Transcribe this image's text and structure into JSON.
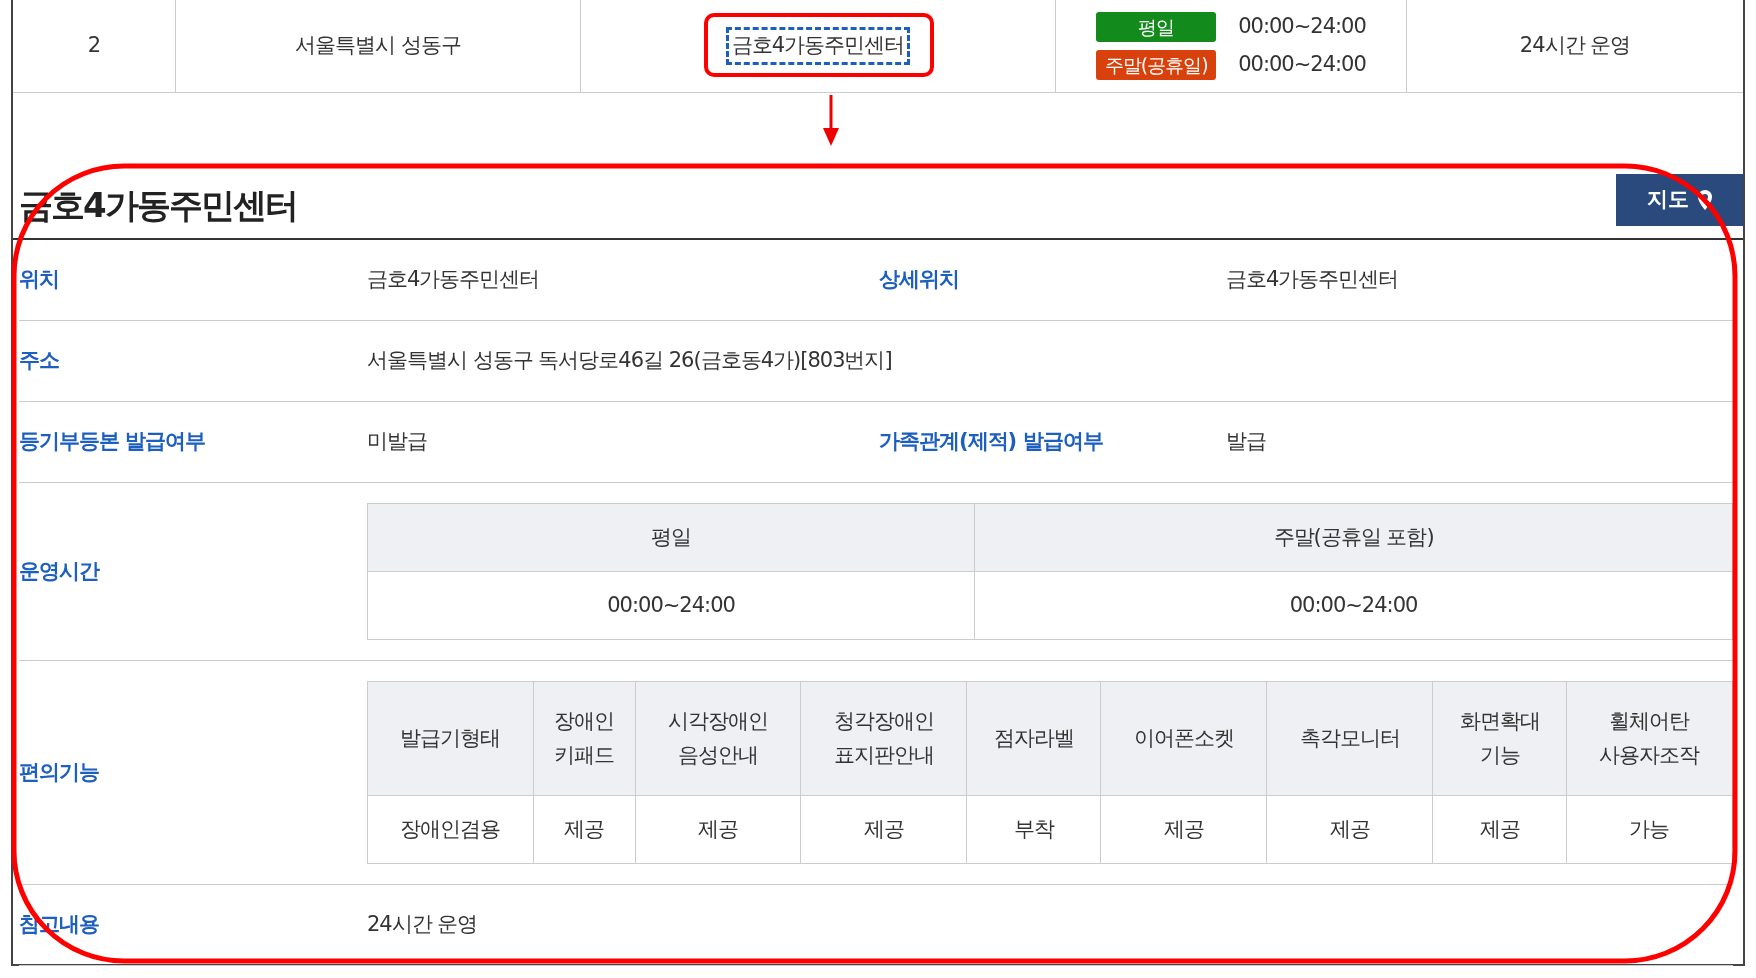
{
  "list_row": {
    "number": "2",
    "region": "서울특별시 성동구",
    "center_link": "금호4가동주민센터",
    "hours": [
      {
        "badge": "평일",
        "color": "#138a1c",
        "time": "00:00~24:00"
      },
      {
        "badge": "주말(공휴일)",
        "color": "#d8410c",
        "time": "00:00~24:00"
      }
    ],
    "note": "24시간 운영"
  },
  "detail": {
    "title": "금호4가동주민센터",
    "map_button": "지도",
    "rows": [
      {
        "kind": "pair",
        "label": "위치",
        "value": "금호4가동주민센터",
        "label2": "상세위치",
        "value2": "금호4가동주민센터"
      },
      {
        "kind": "single",
        "label": "주소",
        "value": "서울특별시 성동구 독서당로46길 26(금호동4가)[803번지]"
      },
      {
        "kind": "pair",
        "label": "등기부등본 발급여부",
        "value": "미발급",
        "label2": "가족관계(제적) 발급여부",
        "value2": "발급"
      },
      {
        "kind": "table",
        "label": "운영시간",
        "columns": [
          "평일",
          "주말(공휴일 포함)"
        ],
        "values": [
          "00:00~24:00",
          "00:00~24:00"
        ]
      },
      {
        "kind": "table",
        "label": "편의기능",
        "columns": [
          "발급기형태",
          "장애인\n키패드",
          "시각장애인\n음성안내",
          "청각장애인\n표지판안내",
          "점자라벨",
          "이어폰소켓",
          "촉각모니터",
          "화면확대\n기능",
          "휠체어탄\n사용자조작"
        ],
        "values": [
          "장애인겸용",
          "제공",
          "제공",
          "제공",
          "부착",
          "제공",
          "제공",
          "제공",
          "가능"
        ]
      },
      {
        "kind": "single",
        "label": "참고내용",
        "value": "24시간 운영"
      }
    ]
  }
}
